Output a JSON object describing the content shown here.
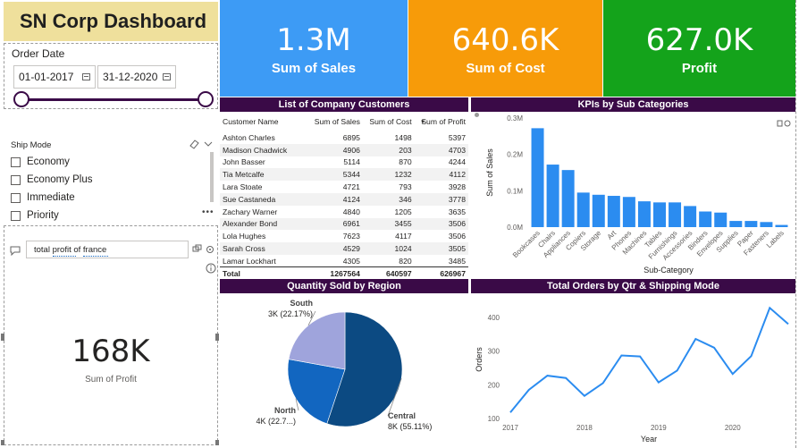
{
  "title": "SN Corp Dashboard",
  "kpis": [
    {
      "value": "1.3M",
      "label": "Sum of Sales",
      "color": "#3d9bf5"
    },
    {
      "value": "640.6K",
      "label": "Sum of Cost",
      "color": "#f79b09"
    },
    {
      "value": "627.0K",
      "label": "Profit",
      "color": "#14a31b"
    }
  ],
  "date_slicer": {
    "title": "Order Date",
    "start": "01-01-2017",
    "end": "31-12-2020"
  },
  "ship_mode": {
    "title": "Ship Mode",
    "options": [
      "Economy",
      "Economy Plus",
      "Immediate",
      "Priority"
    ]
  },
  "qa": {
    "query": "total profit of france",
    "value": "168K",
    "label": "Sum of Profit"
  },
  "customers": {
    "title": "List of Company Customers",
    "columns": [
      "Customer Name",
      "Sum of Sales",
      "Sum of Cost",
      "Sum of Profit"
    ],
    "rows": [
      [
        "Ashton Charles",
        "6895",
        "1498",
        "5397"
      ],
      [
        "Madison Chadwick",
        "4906",
        "203",
        "4703"
      ],
      [
        "John Basser",
        "5114",
        "870",
        "4244"
      ],
      [
        "Tia Metcalfe",
        "5344",
        "1232",
        "4112"
      ],
      [
        "Lara Stoate",
        "4721",
        "793",
        "3928"
      ],
      [
        "Sue Castaneda",
        "4124",
        "346",
        "3778"
      ],
      [
        "Zachary Warner",
        "4840",
        "1205",
        "3635"
      ],
      [
        "Alexander Bond",
        "6961",
        "3455",
        "3506"
      ],
      [
        "Lola Hughes",
        "7623",
        "4117",
        "3506"
      ],
      [
        "Sarah Cross",
        "4529",
        "1024",
        "3505"
      ],
      [
        "Lamar Lockhart",
        "4305",
        "820",
        "3485"
      ]
    ],
    "total": [
      "Total",
      "1267564",
      "640597",
      "626967"
    ]
  },
  "chart_titles": {
    "kpi_sub": "KPIs by Sub Categories",
    "region": "Quantity Sold by Region",
    "orders": "Total Orders by Qtr & Shipping Mode"
  },
  "chart_data": [
    {
      "type": "bar",
      "title": "KPIs by Sub Categories",
      "xlabel": "Sub-Category",
      "ylabel": "Sum of Sales",
      "ylim": [
        0,
        300000
      ],
      "yticks": [
        "0.0M",
        "0.1M",
        "0.2M",
        "0.3M"
      ],
      "categories": [
        "Bookcases",
        "Chairs",
        "Appliances",
        "Copiers",
        "Storage",
        "Art",
        "Phones",
        "Machines",
        "Tables",
        "Furnishings",
        "Accessories",
        "Binders",
        "Envelopes",
        "Supplies",
        "Paper",
        "Fasteners",
        "Labels"
      ],
      "values": [
        272000,
        172000,
        157000,
        95000,
        89000,
        86000,
        83000,
        71000,
        68000,
        68000,
        58000,
        43000,
        40000,
        17000,
        17000,
        14000,
        6000
      ],
      "color": "#2b8cf0"
    },
    {
      "type": "pie",
      "title": "Quantity Sold by Region",
      "labels": [
        "Central",
        "North",
        "South"
      ],
      "values": [
        55.11,
        22.72,
        22.17
      ],
      "slice_labels": [
        "Central\n8K (55.11%)",
        "North\n4K (22.7...)",
        "South\n3K (22.17%)"
      ],
      "colors": [
        "#0c4a82",
        "#1266c0",
        "#9fa4dc"
      ]
    },
    {
      "type": "line",
      "title": "Total Orders by Qtr & Shipping Mode",
      "xlabel": "Year",
      "ylabel": "Orders",
      "ylim": [
        100,
        450
      ],
      "yticks": [
        100,
        200,
        300,
        400
      ],
      "xticks": [
        "2017",
        "2018",
        "2019",
        "2020"
      ],
      "x": [
        "2017 Q1",
        "2017 Q2",
        "2017 Q3",
        "2017 Q4",
        "2018 Q1",
        "2018 Q2",
        "2018 Q3",
        "2018 Q4",
        "2019 Q1",
        "2019 Q2",
        "2019 Q3",
        "2019 Q4",
        "2020 Q1",
        "2020 Q2",
        "2020 Q3",
        "2020 Q4"
      ],
      "values": [
        118,
        185,
        227,
        220,
        167,
        205,
        287,
        284,
        207,
        242,
        336,
        310,
        232,
        285,
        428,
        380
      ],
      "color": "#2b8cf0"
    }
  ]
}
